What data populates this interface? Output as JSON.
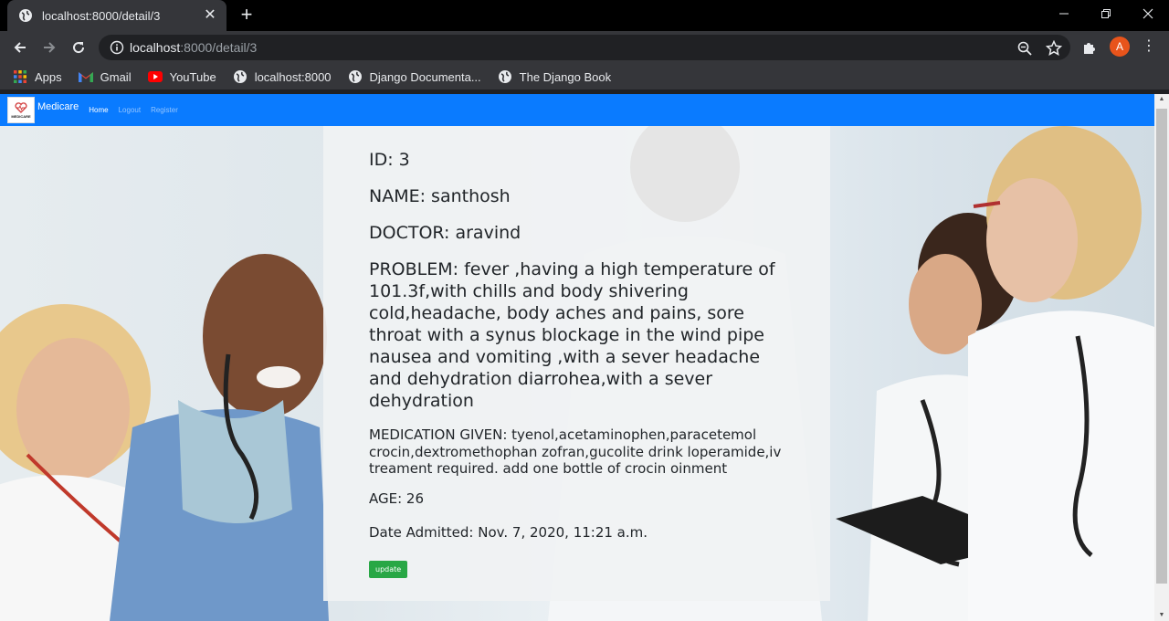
{
  "browser": {
    "tab_title": "localhost:8000/detail/3",
    "url_host": "localhost",
    "url_path": ":8000/detail/3",
    "avatar_letter": "A",
    "bookmarks": [
      "Apps",
      "Gmail",
      "YouTube",
      "localhost:8000",
      "Django Documenta...",
      "The Django Book"
    ]
  },
  "navbar": {
    "logo_text": "MEDICARE",
    "brand": "Medicare",
    "links": [
      "Home",
      "Logout",
      "Register"
    ]
  },
  "patient": {
    "id_label": "ID: 3",
    "name_label": "NAME: santhosh",
    "doctor_label": "DOCTOR: aravind",
    "problem_label": "PROBLEM: fever ,having a high temperature of 101.3f,with chills and body shivering cold,headache, body aches and pains, sore throat with a synus blockage in the wind pipe nausea and vomiting ,with a sever headache and dehydration diarrohea,with a sever dehydration",
    "medication_label": "MEDICATION GIVEN: tyenol,acetaminophen,paracetemol crocin,dextromethophan zofran,gucolite drink loperamide,iv treament required. add one bottle of crocin oinment",
    "age_label": "AGE: 26",
    "date_label": "Date Admitted: Nov. 7, 2020, 11:21 a.m.",
    "update_button": "update"
  },
  "colors": {
    "navbar": "#0a7bff",
    "update_button": "#28a745",
    "avatar": "#e8541b"
  }
}
